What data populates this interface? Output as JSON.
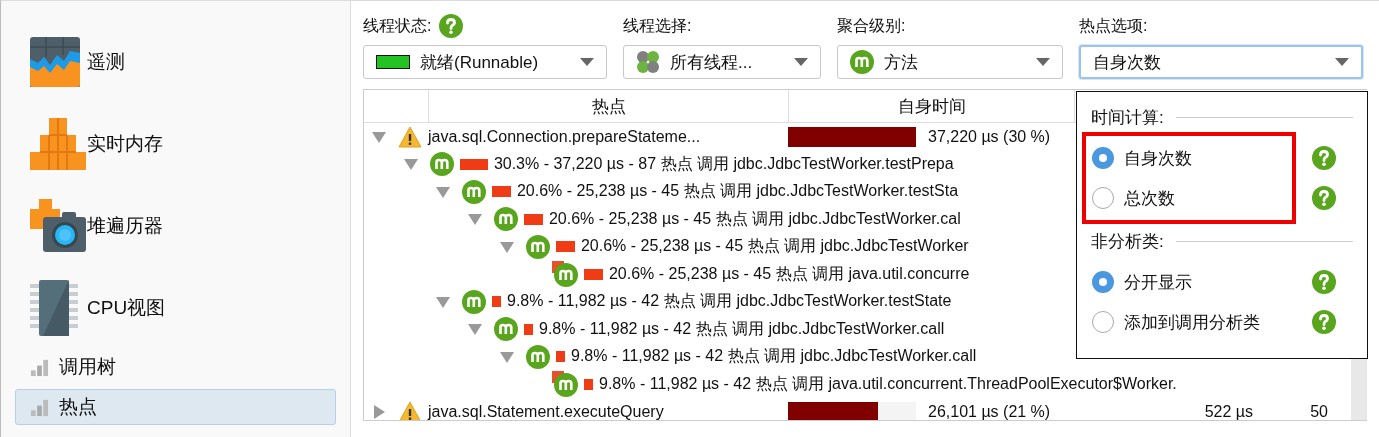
{
  "sidebar": {
    "items": [
      {
        "label": "遥测",
        "kind": "telemetry",
        "selected": false
      },
      {
        "label": "实时内存",
        "kind": "memory",
        "selected": false
      },
      {
        "label": "堆遍历器",
        "kind": "heap",
        "selected": false
      },
      {
        "label": "CPU视图",
        "kind": "cpu",
        "selected": false
      },
      {
        "label": "调用树",
        "kind": "view",
        "selected": false
      },
      {
        "label": "热点",
        "kind": "view",
        "selected": true
      }
    ]
  },
  "filters": [
    {
      "label": "线程状态:",
      "help": true,
      "value": "就绪(Runnable)",
      "kind": "state",
      "focused": false
    },
    {
      "label": "线程选择:",
      "help": false,
      "value": "所有线程...",
      "kind": "threads",
      "focused": false
    },
    {
      "label": "聚合级别:",
      "help": false,
      "value": "方法",
      "kind": "method",
      "focused": false
    },
    {
      "label": "热点选项:",
      "help": false,
      "value": "自身次数",
      "kind": "plain",
      "focused": true
    }
  ],
  "hotspots": {
    "columns": [
      "热点",
      "自身时间"
    ],
    "rows": [
      {
        "kind": "warning",
        "name": "java.sql.Connection.prepareStateme...",
        "expanded": true,
        "level": 1,
        "self_time": "37,220 µs (30 %)",
        "children": [
          {
            "kind": "method",
            "text": "30.3% - 37,220 µs - 87 热点 调用 jdbc.JdbcTestWorker.testPrepa",
            "expanded": true,
            "children": [
              {
                "kind": "method",
                "text": "20.6% - 25,238 µs - 45 热点 调用 jdbc.JdbcTestWorker.testSta",
                "expanded": true,
                "children": [
                  {
                    "kind": "method",
                    "text": "20.6% - 25,238 µs - 45 热点 调用 jdbc.JdbcTestWorker.cal",
                    "expanded": true,
                    "children": [
                      {
                        "kind": "method",
                        "text": "20.6% - 25,238 µs - 45 热点 调用 jdbc.JdbcTestWorker",
                        "expanded": true,
                        "children": [
                          {
                            "kind": "leaf",
                            "text": "20.6% - 25,238 µs - 45 热点 调用 java.util.concurre"
                          }
                        ]
                      }
                    ]
                  }
                ]
              },
              {
                "kind": "method",
                "text": "9.8% - 11,982 µs - 42 热点 调用 jdbc.JdbcTestWorker.testState",
                "expanded": true,
                "children": [
                  {
                    "kind": "method",
                    "text": "9.8% - 11,982 µs - 42 热点 调用 jdbc.JdbcTestWorker.call",
                    "expanded": true,
                    "children": [
                      {
                        "kind": "method",
                        "text": "9.8% - 11,982 µs - 42 热点 调用 jdbc.JdbcTestWorker.call",
                        "expanded": true,
                        "children": [
                          {
                            "kind": "leaf",
                            "text": "9.8% - 11,982 µs - 42 热点 调用 java.util.concurrent.ThreadPoolExecutor$Worker."
                          }
                        ]
                      }
                    ]
                  }
                ]
              }
            ]
          }
        ]
      },
      {
        "kind": "warning",
        "name": "java.sql.Statement.executeQuery",
        "expanded": false,
        "level": 0.7,
        "self_time": "26,101 µs (21 %)",
        "column_3": "522 µs",
        "column_4": "50"
      }
    ]
  },
  "popup": {
    "sections": [
      {
        "title": "时间计算:",
        "highlighted": true,
        "options": [
          {
            "label": "自身次数",
            "selected": true
          },
          {
            "label": "总次数",
            "selected": false
          }
        ]
      },
      {
        "title": "非分析类:",
        "highlighted": false,
        "options": [
          {
            "label": "分开显示",
            "selected": true
          },
          {
            "label": "添加到调用分析类",
            "selected": false
          }
        ]
      }
    ]
  }
}
